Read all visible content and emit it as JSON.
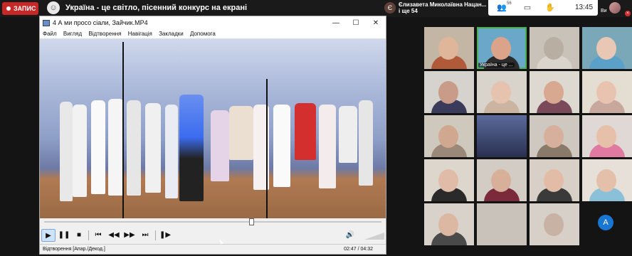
{
  "header": {
    "record_label": "ЗАПИС",
    "share_title": "Україна - це світло, пісенний конкурс на екрані",
    "host_name_line1": "Єлизавета Миколаївна Нацан...",
    "host_name_line2": "і ще 54",
    "host_initial": "Є"
  },
  "toolbar": {
    "people_count": "56",
    "time": "13:45",
    "self_name": "Ви",
    "self_close": "×"
  },
  "player": {
    "title": "4 А ми просо сіали, Зайчик.MP4",
    "menu": [
      "Файл",
      "Вигляд",
      "Відтворення",
      "Навігація",
      "Закладки",
      "Допомога"
    ],
    "status_left": "Відтворення [Апар./Декод.]",
    "status_right": "02:47 / 04:32",
    "progress": 0.613
  },
  "participants": {
    "highlight_label": "Україна - це ...",
    "fab_initial": "A"
  },
  "colors": {
    "record": "#c62828",
    "speaker_highlight": "#4caf50",
    "fab": "#1976d2"
  }
}
